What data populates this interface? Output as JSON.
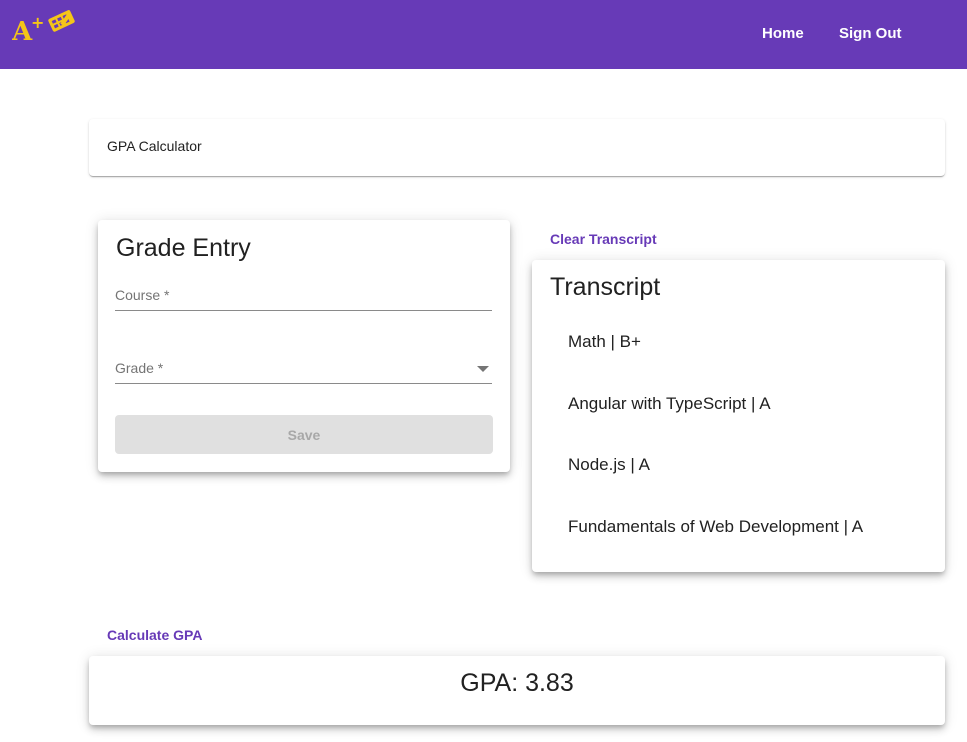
{
  "header": {
    "nav": {
      "home_label": "Home",
      "signout_label": "Sign Out"
    },
    "accent": "#673ab7",
    "logo_icon": "a-plus-calculator-logo-icon",
    "logo_text": "A+"
  },
  "page": {
    "title": "GPA Calculator"
  },
  "grade_entry": {
    "heading": "Grade Entry",
    "course_label": "Course *",
    "grade_label": "Grade *",
    "save_label": "Save"
  },
  "transcript": {
    "clear_label": "Clear Transcript",
    "heading": "Transcript",
    "items": [
      "Math | B+",
      "Angular with TypeScript | A",
      "Node.js | A",
      "Fundamentals of Web Development | A"
    ]
  },
  "gpa": {
    "calculate_label": "Calculate GPA",
    "result": "GPA: 3.83"
  }
}
